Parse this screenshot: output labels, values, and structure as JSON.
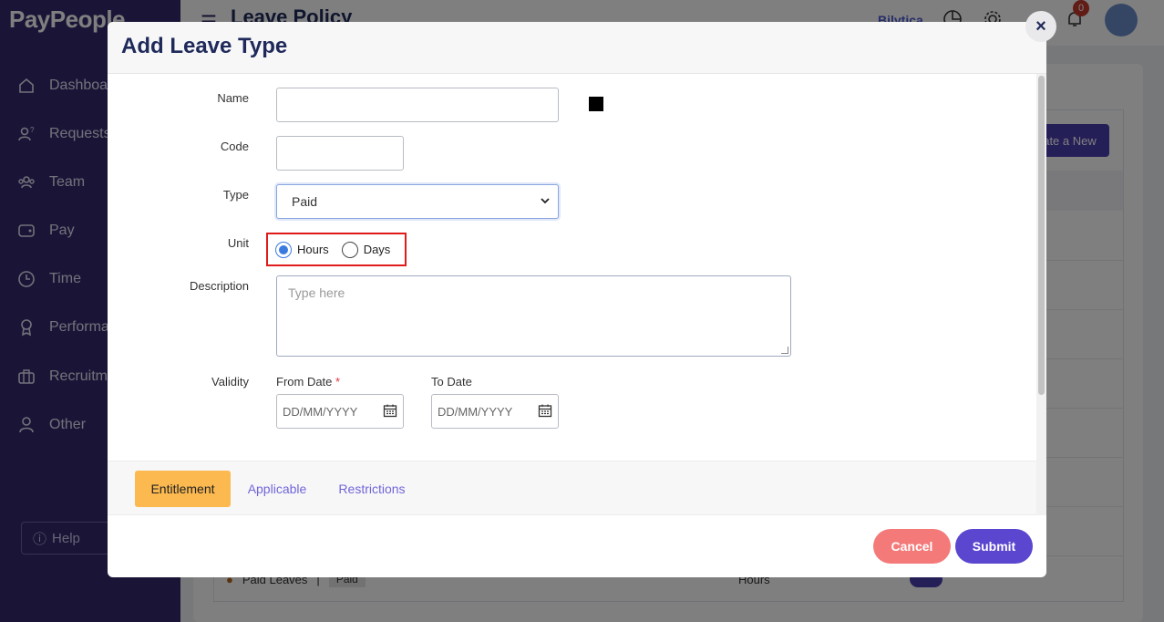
{
  "app": {
    "logo": "PayPeople"
  },
  "sidebar": {
    "items": [
      {
        "label": "Dashboa",
        "icon": "home-icon"
      },
      {
        "label": "Requests",
        "icon": "requests-icon"
      },
      {
        "label": "Team",
        "icon": "team-icon"
      },
      {
        "label": "Pay",
        "icon": "wallet-icon"
      },
      {
        "label": "Time",
        "icon": "clock-icon"
      },
      {
        "label": "Performa",
        "icon": "award-icon"
      },
      {
        "label": "Recruitme",
        "icon": "briefcase-icon"
      },
      {
        "label": "Other",
        "icon": "user-icon"
      }
    ],
    "help_label": "Help"
  },
  "header": {
    "title": "Leave Policy",
    "company": "Bilytica",
    "notification_count": "0"
  },
  "background": {
    "create_button": "ate a New",
    "row": {
      "name": "Paid Leaves",
      "separator": "|",
      "type": "Paid",
      "unit": "Hours"
    }
  },
  "modal": {
    "title": "Add Leave Type",
    "close_label": "×",
    "fields": {
      "name_label": "Name",
      "name_value": "",
      "code_label": "Code",
      "code_value": "",
      "type_label": "Type",
      "type_value": "Paid",
      "unit_label": "Unit",
      "unit_options": [
        "Hours",
        "Days"
      ],
      "unit_selected": "Hours",
      "description_label": "Description",
      "description_placeholder": "Type here",
      "validity_label": "Validity",
      "from_date_label": "From Date",
      "from_date_required": "*",
      "to_date_label": "To Date",
      "date_placeholder": "DD/MM/YYYY"
    },
    "tabs": [
      "Entitlement",
      "Applicable",
      "Restrictions"
    ],
    "active_tab": "Entitlement",
    "buttons": {
      "cancel": "Cancel",
      "submit": "Submit"
    }
  }
}
